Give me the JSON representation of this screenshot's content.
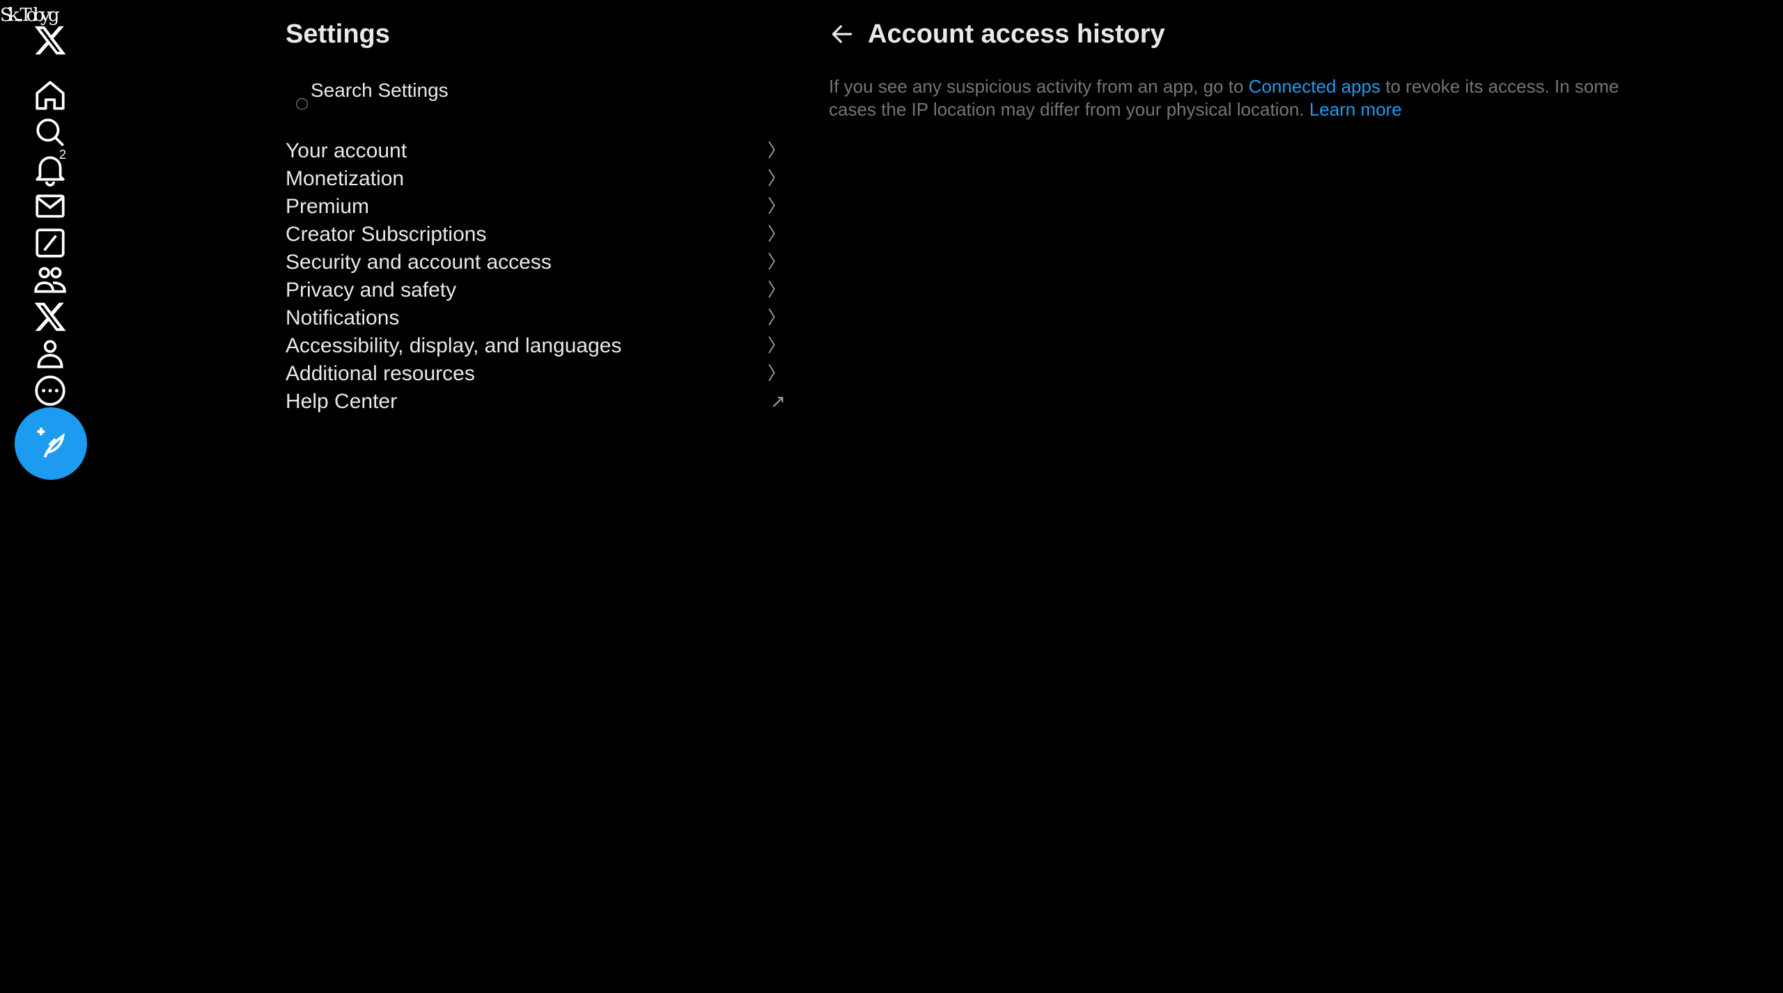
{
  "nav": {
    "glitch_text": "Sk...Toby g",
    "notification_count": "2",
    "icons": [
      "x-logo-icon",
      "home-icon",
      "search-icon",
      "bell-icon",
      "mail-icon",
      "grok-icon",
      "communities-icon",
      "premium-x-icon",
      "profile-icon",
      "more-icon"
    ],
    "compose_icon": "feather-plus-icon",
    "accent": "#1d9bf0"
  },
  "settings": {
    "title": "Settings",
    "search_placeholder": "Search Settings",
    "items": [
      {
        "label": "Your account",
        "icon": "chevron-right-icon"
      },
      {
        "label": "Monetization",
        "icon": "chevron-right-icon"
      },
      {
        "label": "Premium",
        "icon": "chevron-right-icon"
      },
      {
        "label": "Creator Subscriptions",
        "icon": "chevron-right-icon"
      },
      {
        "label": "Security and account access",
        "icon": "chevron-right-icon"
      },
      {
        "label": "Privacy and safety",
        "icon": "chevron-right-icon"
      },
      {
        "label": "Notifications",
        "icon": "chevron-right-icon"
      },
      {
        "label": "Accessibility, display, and languages",
        "icon": "chevron-right-icon"
      },
      {
        "label": "Additional resources",
        "icon": "chevron-right-icon"
      },
      {
        "label": "Help Center",
        "icon": "external-link-icon"
      }
    ]
  },
  "detail": {
    "title": "Account access history",
    "desc_part1": "If you see any suspicious activity from an app, go to ",
    "link_connected": "Connected apps",
    "desc_part2": " to revoke its access. In some cases the IP location may differ from your physical location. ",
    "link_learn": "Learn more"
  }
}
